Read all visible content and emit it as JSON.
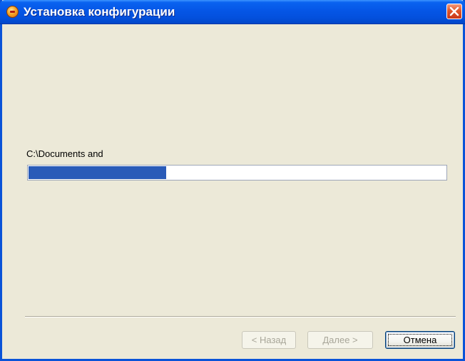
{
  "window": {
    "title": "Установка конфигурации",
    "icon": "app-icon",
    "accent_color": "#0a53d8"
  },
  "progress": {
    "path_text": "C:\\Documents and",
    "fraction": 0.33,
    "fill_color": "#2a5bb8"
  },
  "buttons": {
    "back_label": "< Назад",
    "next_label": "Далее >",
    "cancel_label": "Отмена"
  }
}
